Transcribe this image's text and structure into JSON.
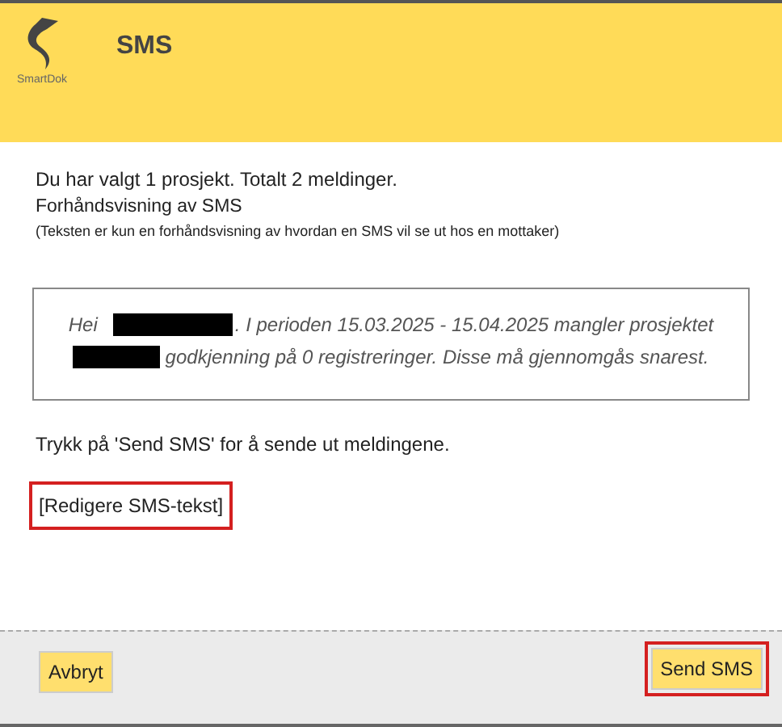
{
  "header": {
    "logo_text": "SmartDok",
    "title": "SMS"
  },
  "summary": "Du har valgt 1 prosjekt. Totalt 2 meldinger.",
  "preview_heading": "Forhåndsvisning av SMS",
  "preview_note": "(Teksten er kun en forhåndsvisning av hvordan en SMS vil se ut hos en mottaker)",
  "message_lines": [
    [
      {
        "kind": "text",
        "text": "Hei"
      },
      {
        "kind": "redacted"
      },
      {
        "kind": "text",
        "text": ". I perioden 15.03.2025 - 15.04.2025 mangler prosjektet"
      }
    ],
    [
      {
        "kind": "redacted"
      },
      {
        "kind": "text",
        "text": "godkjenning på 0 registreringer. Disse må gjennomgås snarest."
      }
    ]
  ],
  "instruction": "Trykk på 'Send SMS' for å sende ut meldingene.",
  "edit_link": {
    "label": "[Redigere SMS-tekst]",
    "highlighted": true
  },
  "buttons": [
    {
      "label": "Avbryt",
      "highlighted": false
    },
    {
      "label": "Send SMS",
      "highlighted": true
    }
  ]
}
